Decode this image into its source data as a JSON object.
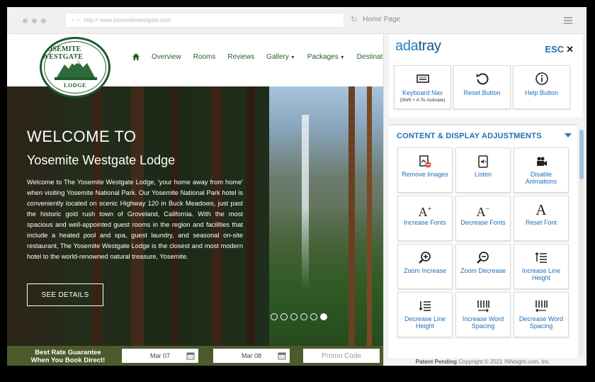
{
  "browser": {
    "url": "http://   www.yosemitewestgate.com",
    "tab_title": "Home Page"
  },
  "site": {
    "logo": {
      "top": "YOSEMITE WESTGATE",
      "bottom": "LODGE"
    },
    "nav": [
      {
        "label": "Overview",
        "has_menu": false
      },
      {
        "label": "Rooms",
        "has_menu": false
      },
      {
        "label": "Reviews",
        "has_menu": false
      },
      {
        "label": "Gallery",
        "has_menu": true
      },
      {
        "label": "Packages",
        "has_menu": true
      },
      {
        "label": "Destination",
        "has_menu": true
      }
    ],
    "hero": {
      "welcome": "WELCOME TO",
      "name": "Yosemite Westgate Lodge",
      "blurb": "Welcome to The Yosemite Westgate Lodge, 'your home away from home' when visiting Yosemite National Park. Our Yosemite National Park hotel is conveniently located on scenic Highway 120 in Buck Meadows, just past the historic gold rush town of Groveland, California. With the most spacious and well-appointed guest rooms in the region and facilities that include a heated pool and spa, guest laundry, and seasonal on-site restaurant, The Yosemite Westgate Lodge is the closest and most modern hotel to the world-renowned natural treasure, Yosemite.",
      "cta": "SEE DETAILS",
      "slides": 6,
      "active_slide": 6
    },
    "booking": {
      "best_rate": "Best Rate Guarantee When You Book Direct!",
      "checkin": "Mar 07",
      "checkout": "Mar 08",
      "promo_placeholder": "Promo Code"
    }
  },
  "tray": {
    "logo_ada": "ada",
    "logo_tray": "tray",
    "esc": "ESC",
    "top_buttons": [
      {
        "label": "Keyboard Nav",
        "sub": "(Shift + A To Activate)",
        "icon": "keyboard-icon"
      },
      {
        "label": "Reset Button",
        "sub": "",
        "icon": "reset-icon"
      },
      {
        "label": "Help Button",
        "sub": "",
        "icon": "info-icon"
      }
    ],
    "section_title": "CONTENT & DISPLAY ADJUSTMENTS",
    "grid_buttons": [
      {
        "label": "Remove Images",
        "icon": "remove-images-icon"
      },
      {
        "label": "Listen",
        "icon": "listen-icon"
      },
      {
        "label": "Disable Animations",
        "icon": "video-camera-icon"
      },
      {
        "label": "Increase Fonts",
        "icon": "font-increase-icon"
      },
      {
        "label": "Decrease Fonts",
        "icon": "font-decrease-icon"
      },
      {
        "label": "Reset Font",
        "icon": "font-reset-icon"
      },
      {
        "label": "Zoom Increase",
        "icon": "zoom-in-icon"
      },
      {
        "label": "Zoom Decrease",
        "icon": "zoom-out-icon"
      },
      {
        "label": "Increase Line Height",
        "icon": "line-height-increase-icon"
      },
      {
        "label": "Decrease Line Height",
        "icon": "line-height-decrease-icon"
      },
      {
        "label": "Increase Word Spacing",
        "icon": "word-spacing-increase-icon"
      },
      {
        "label": "Decrease Word Spacing",
        "icon": "word-spacing-decrease-icon"
      }
    ],
    "footer_bold": "Patent Pending",
    "footer_text": "Copyright © 2021 INNsight.com, Inc."
  },
  "colors": {
    "site_green": "#2d5b2a",
    "booking_bar": "#4d5a2c",
    "tray_blue": "#1d6fb8"
  }
}
